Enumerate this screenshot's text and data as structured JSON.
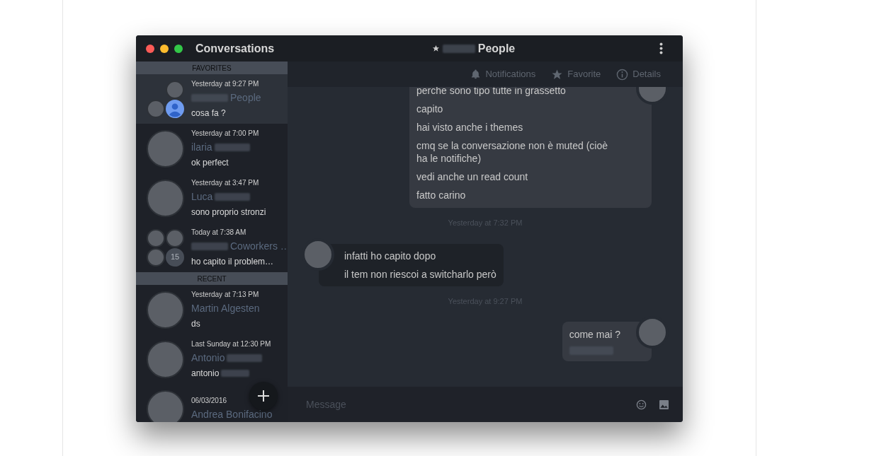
{
  "window": {
    "title": "Conversations",
    "chat_title": {
      "starred": true,
      "blurred_prefix": true,
      "text": "People"
    }
  },
  "sidebar": {
    "sections": [
      {
        "title": "FAVORITES",
        "items": [
          {
            "time": "Yesterday at 9:27 PM",
            "name": "People",
            "blur_before": true,
            "preview": "cosa fa ?",
            "selected": true,
            "avatar": {
              "kind": "group",
              "members": [
                {
                  "kind": "photo"
                },
                {
                  "kind": "photo"
                },
                {
                  "kind": "person"
                }
              ]
            }
          },
          {
            "time": "Yesterday at 7:00 PM",
            "name": "ilaria",
            "blur_after": true,
            "preview": "ok perfect",
            "selected": false,
            "avatar": {
              "kind": "photo"
            }
          },
          {
            "time": "Yesterday at 3:47 PM",
            "name": "Luca",
            "blur_after": true,
            "preview": "sono proprio stronzi",
            "selected": false,
            "avatar": {
              "kind": "photo"
            }
          },
          {
            "time": "Today at 7:38 AM",
            "name": "Coworkers …",
            "blur_before": true,
            "preview": "ho capito il problem…",
            "selected": false,
            "avatar": {
              "kind": "group",
              "members": [
                {
                  "kind": "photo"
                },
                {
                  "kind": "photo"
                },
                {
                  "kind": "photo"
                }
              ],
              "count": "15"
            }
          }
        ]
      },
      {
        "title": "RECENT",
        "items": [
          {
            "time": "Yesterday at 7:13 PM",
            "name": "Martin Algesten",
            "preview": "ds",
            "selected": false,
            "avatar": {
              "kind": "photo"
            }
          },
          {
            "time": "Last Sunday at 12:30 PM",
            "name": "Antonio",
            "blur_after": true,
            "preview": "antonio",
            "preview_blur": true,
            "selected": false,
            "avatar": {
              "kind": "photo"
            }
          },
          {
            "time": "06/03/2016",
            "name": "Andrea Bonifacino",
            "selected": false,
            "avatar": {
              "kind": "photo"
            }
          }
        ]
      }
    ]
  },
  "toolbar": [
    {
      "kind": "bell",
      "label": "Notifications"
    },
    {
      "kind": "star",
      "label": "Favorite"
    },
    {
      "kind": "info",
      "label": "Details"
    }
  ],
  "messages": [
    {
      "kind": "outgoing",
      "lines": [
        {
          "text": "perche sono tipo tutte in grassetto"
        },
        {
          "text": "capito"
        },
        {
          "text": "hai visto anche i themes"
        },
        {
          "text": "cmq se la conversazione non è muted (cioè ha le notifiche)"
        },
        {
          "text": "vedi anche un read count"
        },
        {
          "text": "fatto carino"
        }
      ]
    },
    {
      "kind": "time",
      "text": "Yesterday at 7:32 PM"
    },
    {
      "kind": "incoming",
      "lines": [
        {
          "text": "infatti ho capito dopo"
        },
        {
          "text": "il tem non riescoi a switcharlo però"
        }
      ]
    },
    {
      "kind": "time",
      "text": "Yesterday at 9:27 PM"
    },
    {
      "kind": "outgoing",
      "lines": [
        {
          "text": "come mai ?"
        },
        {
          "blurred": true
        }
      ]
    }
  ],
  "composer": {
    "placeholder": "Message"
  }
}
